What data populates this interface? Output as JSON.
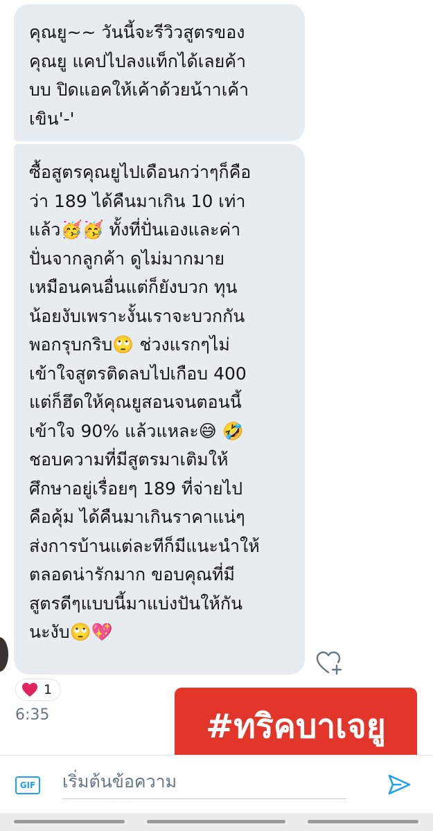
{
  "messages": [
    {
      "lines": [
        "คุณยู~~ วันนี้จะรีวิวสูตรของ",
        "คุณยู แคปไปลงแท็กได้เลยค้า",
        "บบ ปิดแอคให้เค้าด้วยน้าาเค้า",
        "เขิน'-'"
      ]
    },
    {
      "lines": [
        "ซื้อสูตรคุณยูไปเดือนกว่าๆก็คือ",
        "ว่า 189 ได้คืนมาเกิน 10 เท่า",
        "แล้ว🥳🥳 ทั้งที่ปั่นเองและค่า",
        "ปั่นจากลูกค้า ดูไม่มากมาย",
        "เหมือนคนอื่นแต่ก็ยังบวก ทุน",
        "น้อยงับเพราะงั้นเราจะบวกกัน",
        "พอกรุบกริบ🙄 ช่วงแรกๆไม่",
        "เข้าใจสูตรติดลบไปเกือบ 400",
        "แต่ก็ฮึดให้คุณยูสอนจนตอนนี้",
        "เข้าใจ 90% แล้วแหละ😅 🤣",
        "ชอบความที่มีสูตรมาเติมให้",
        "ศึกษาอยู่เรื่อยๆ 189 ที่จ่ายไป",
        "คือคุ้ม ได้คืนมาเกินราคาแน่ๆ",
        "ส่งการบ้านแต่ละทีก็มีแนะนำให้",
        "ตลอดน่ารักมาก ขอบคุณที่มี",
        "สูตรดีๆแบบนี้มาแบ่งปันให้กัน",
        "นะงับ🙄💖"
      ]
    }
  ],
  "reaction": {
    "icon": "heart-icon",
    "count": "1"
  },
  "timestamp": "6:35",
  "hashtag": "#ทริคบาเจยู",
  "composer": {
    "gif_label": "GIF",
    "placeholder": "เริ่มต้นข้อความ"
  },
  "colors": {
    "bubble": "#e6ecf0",
    "accent": "#1da1f2",
    "banner": "#e3362a",
    "heart": "#e0245e"
  }
}
